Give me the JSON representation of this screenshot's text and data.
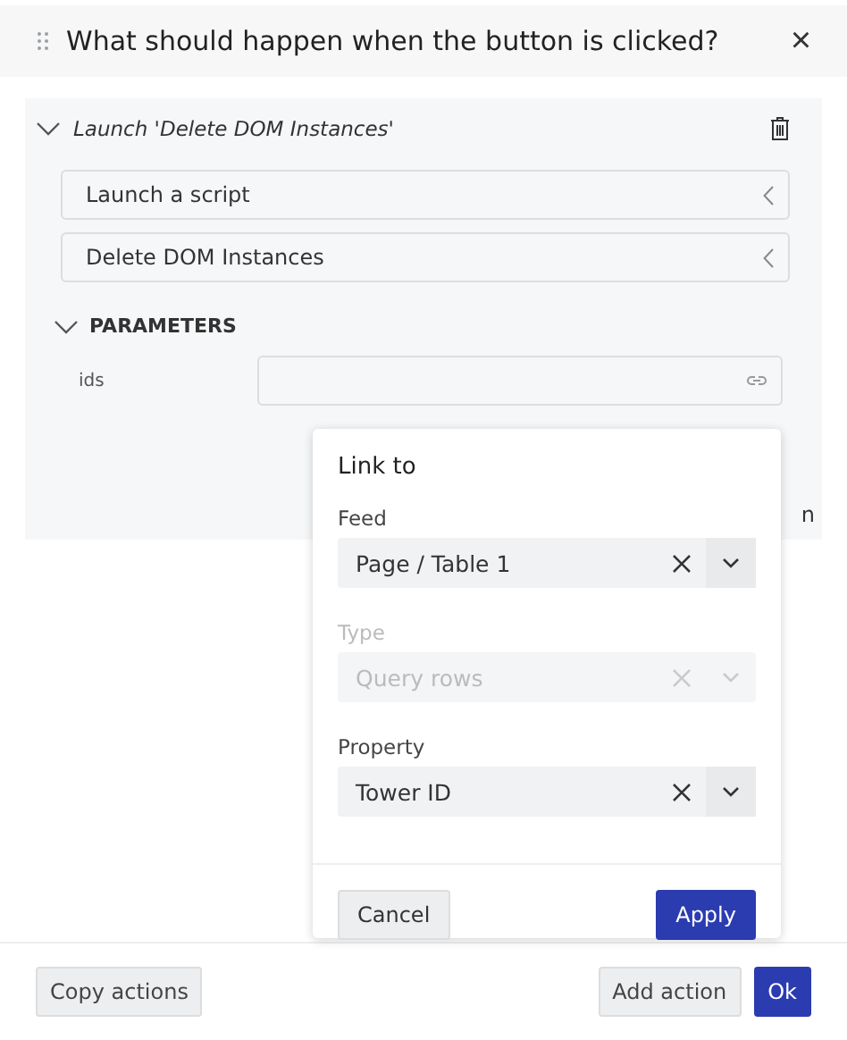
{
  "dialog": {
    "title": "What should happen when the button is clicked?",
    "close": "×"
  },
  "action": {
    "title": "Launch 'Delete DOM Instances'",
    "expanded": true,
    "selects": [
      "Launch a script",
      "Delete DOM Instances"
    ],
    "parameters": {
      "title": "PARAMETERS",
      "expanded": true,
      "fields": [
        {
          "label": "ids"
        }
      ]
    },
    "hidden_text": "n"
  },
  "popup": {
    "title": "Link to",
    "fields": [
      {
        "label": "Feed",
        "value": "Page / Table 1",
        "disabled": false
      },
      {
        "label": "Type",
        "value": "Query rows",
        "disabled": true
      },
      {
        "label": "Property",
        "value": "Tower ID",
        "disabled": false
      }
    ],
    "cancel": "Cancel",
    "apply": "Apply"
  },
  "footer": {
    "copy": "Copy actions",
    "add": "Add action",
    "ok": "Ok"
  }
}
